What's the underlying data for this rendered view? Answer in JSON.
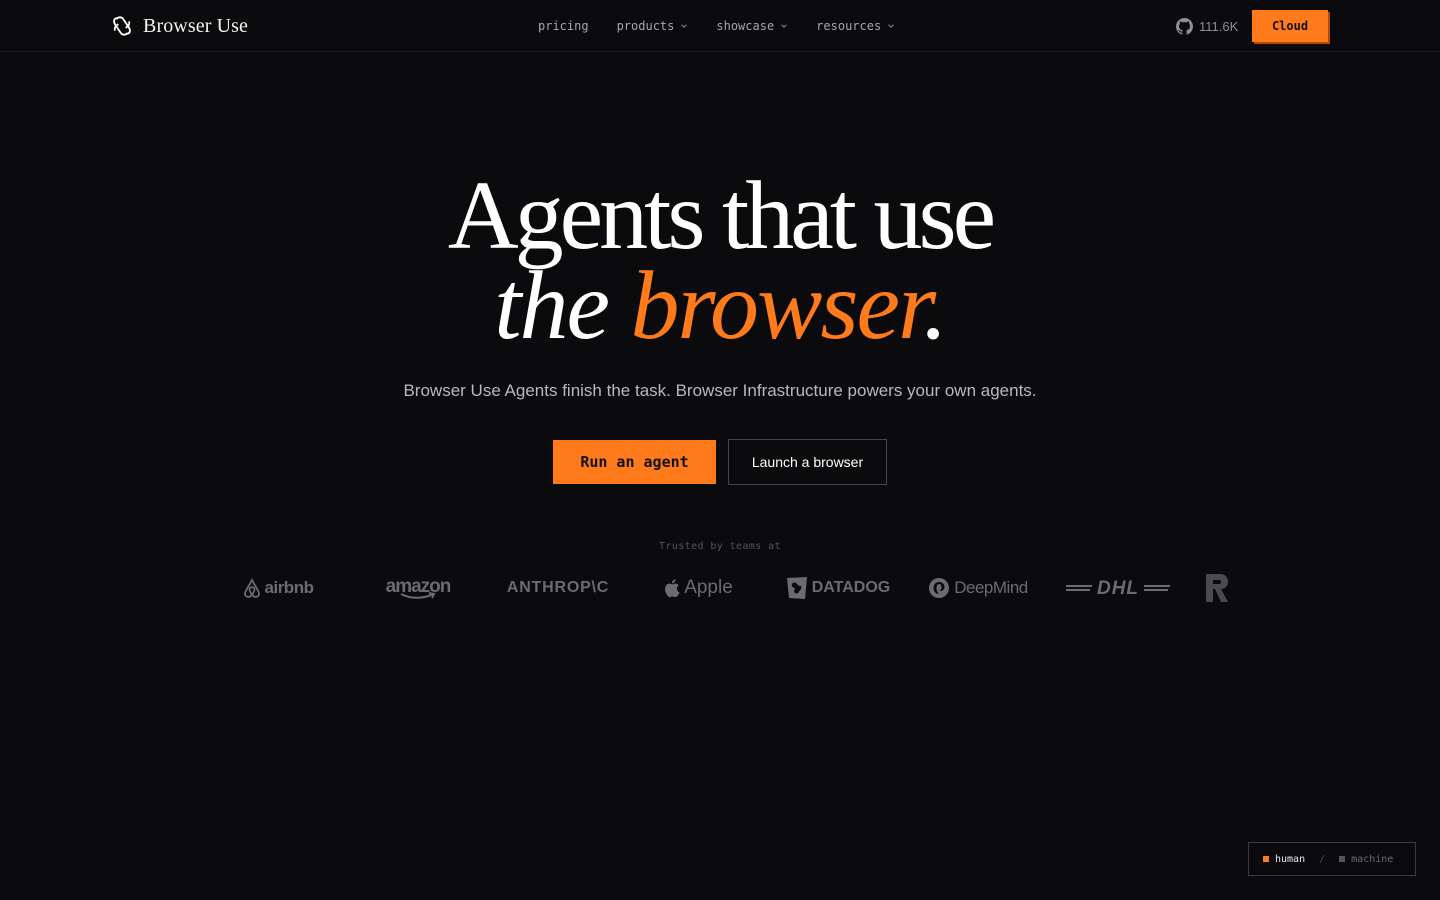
{
  "header": {
    "brand": "Browser Use",
    "nav": [
      {
        "label": "pricing",
        "dropdown": false
      },
      {
        "label": "products",
        "dropdown": true
      },
      {
        "label": "showcase",
        "dropdown": true
      },
      {
        "label": "resources",
        "dropdown": true
      }
    ],
    "github_stars": "111.6K",
    "cloud_label": "Cloud"
  },
  "hero": {
    "title_line1": "Agents that use",
    "title_line2_prefix": "the ",
    "title_line2_accent": "browser",
    "title_line2_suffix": ".",
    "subtitle": "Browser Use Agents finish the task. Browser Infrastructure powers your own agents.",
    "primary_cta": "Run an agent",
    "secondary_cta": "Launch a browser"
  },
  "trusted": {
    "label": "Trusted by teams at",
    "logos": [
      "airbnb",
      "amazon",
      "ANTHROP\\C",
      "Apple",
      "DATADOG",
      "DeepMind",
      "DHL"
    ]
  },
  "mode_toggle": {
    "human": "human",
    "separator": "/",
    "machine": "machine",
    "active": "human"
  },
  "colors": {
    "background": "#0b0b0d",
    "accent": "#ff7a1a",
    "muted_text": "#a6a6ab",
    "logo_gray": "#6b6b70"
  }
}
